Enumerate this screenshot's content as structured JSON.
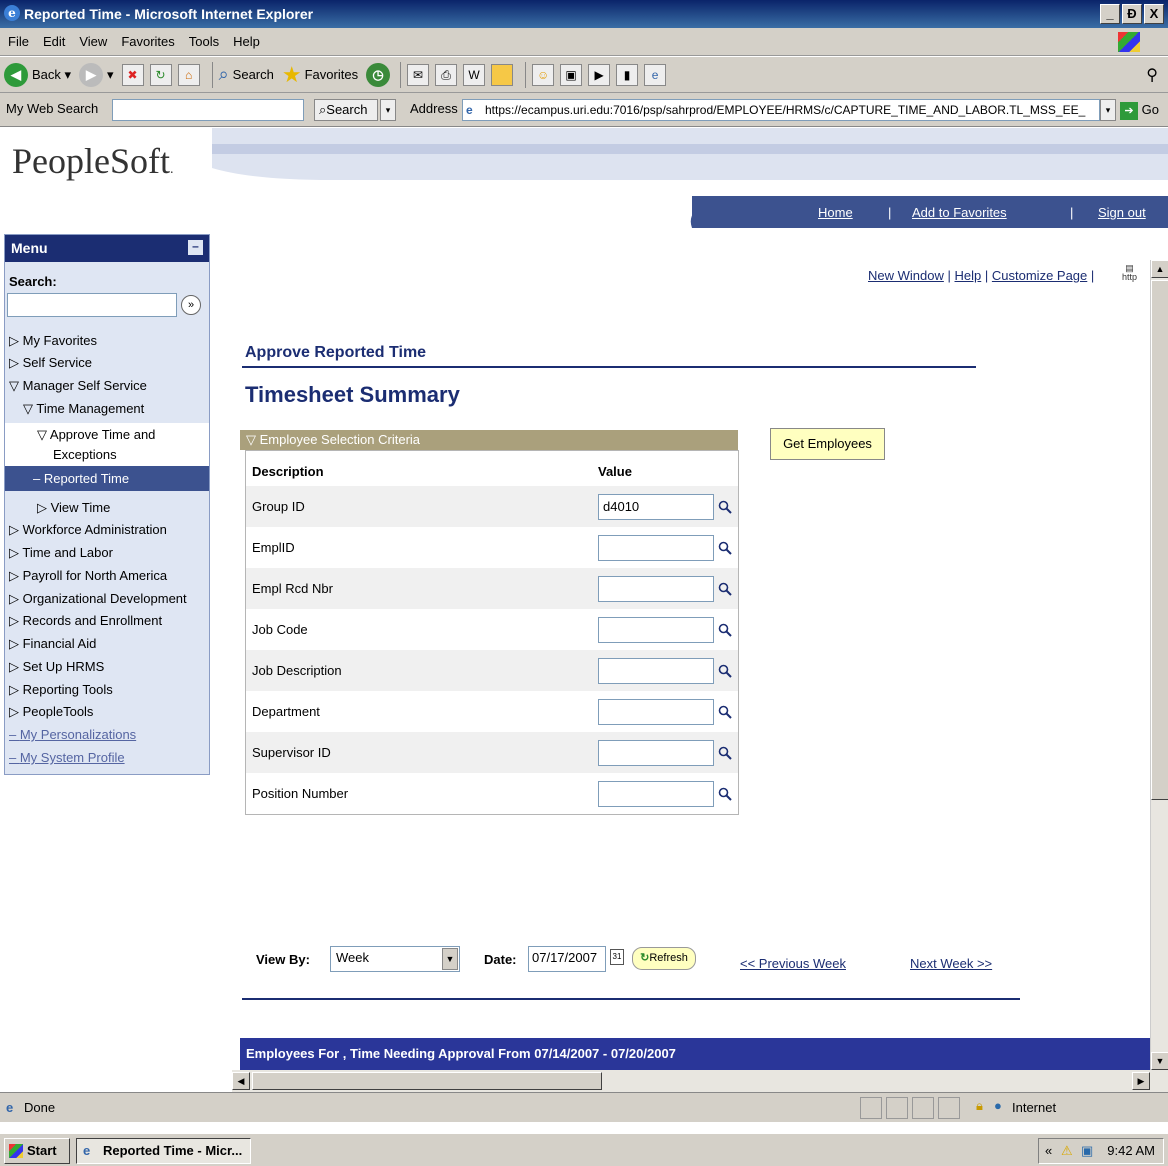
{
  "window": {
    "title": "Reported Time - Microsoft Internet Explorer",
    "minimize": "_",
    "maximize": "Ɖ",
    "close": "X"
  },
  "menubar": [
    "File",
    "Edit",
    "View",
    "Favorites",
    "Tools",
    "Help"
  ],
  "toolbar": {
    "back": "Back",
    "search": "Search",
    "favorites": "Favorites"
  },
  "addressbar": {
    "my_web_search": "My Web Search",
    "search_btn": "Search",
    "address_label": "Address",
    "url": "https://ecampus.uri.edu:7016/psp/sahrprod/EMPLOYEE/HRMS/c/CAPTURE_TIME_AND_LABOR.TL_MSS_EE_",
    "go": "Go"
  },
  "ps": {
    "logo": "PeopleSoft",
    "home": "Home",
    "add_favorites": "Add to Favorites",
    "sign_out": "Sign out"
  },
  "menu": {
    "title": "Menu",
    "search_label": "Search:",
    "items": [
      "My Favorites",
      "Self Service",
      "Manager Self Service",
      "Time Management",
      "Approve Time and",
      "Exceptions",
      "– Reported Time",
      "View Time",
      "Workforce Administration",
      "Time and Labor",
      "Payroll for North America",
      "Organizational Development",
      "Records and Enrollment",
      "Financial Aid",
      "Set Up HRMS",
      "Reporting Tools",
      "PeopleTools",
      "My Personalizations",
      "My System Profile"
    ]
  },
  "toplinks": {
    "new_window": "New Window",
    "help": "Help",
    "customize": "Customize Page",
    "sep": "|"
  },
  "page": {
    "title": "Approve Reported Time",
    "subtitle": "Timesheet Summary",
    "criteria_header": "Employee Selection Criteria",
    "col_description": "Description",
    "col_value": "Value",
    "get_employees": "Get Employees",
    "fields": [
      {
        "label": "Group ID",
        "value": "d4010"
      },
      {
        "label": "EmplID",
        "value": ""
      },
      {
        "label": "Empl Rcd Nbr",
        "value": ""
      },
      {
        "label": "Job Code",
        "value": ""
      },
      {
        "label": "Job Description",
        "value": ""
      },
      {
        "label": "Department",
        "value": ""
      },
      {
        "label": "Supervisor ID",
        "value": ""
      },
      {
        "label": "Position Number",
        "value": ""
      }
    ],
    "view_by_label": "View By:",
    "view_by_value": "Week",
    "date_label": "Date:",
    "date_value": "07/17/2007",
    "refresh": "Refresh",
    "prev_week": "<< Previous Week",
    "next_week": "Next Week >>",
    "employees_bar": "Employees For , Time Needing Approval From 07/14/2007 - 07/20/2007"
  },
  "statusbar": {
    "left": "Done",
    "zone": "Internet"
  },
  "taskbar": {
    "start": "Start",
    "task": "Reported Time - Micr...",
    "clock": "9:42 AM"
  }
}
